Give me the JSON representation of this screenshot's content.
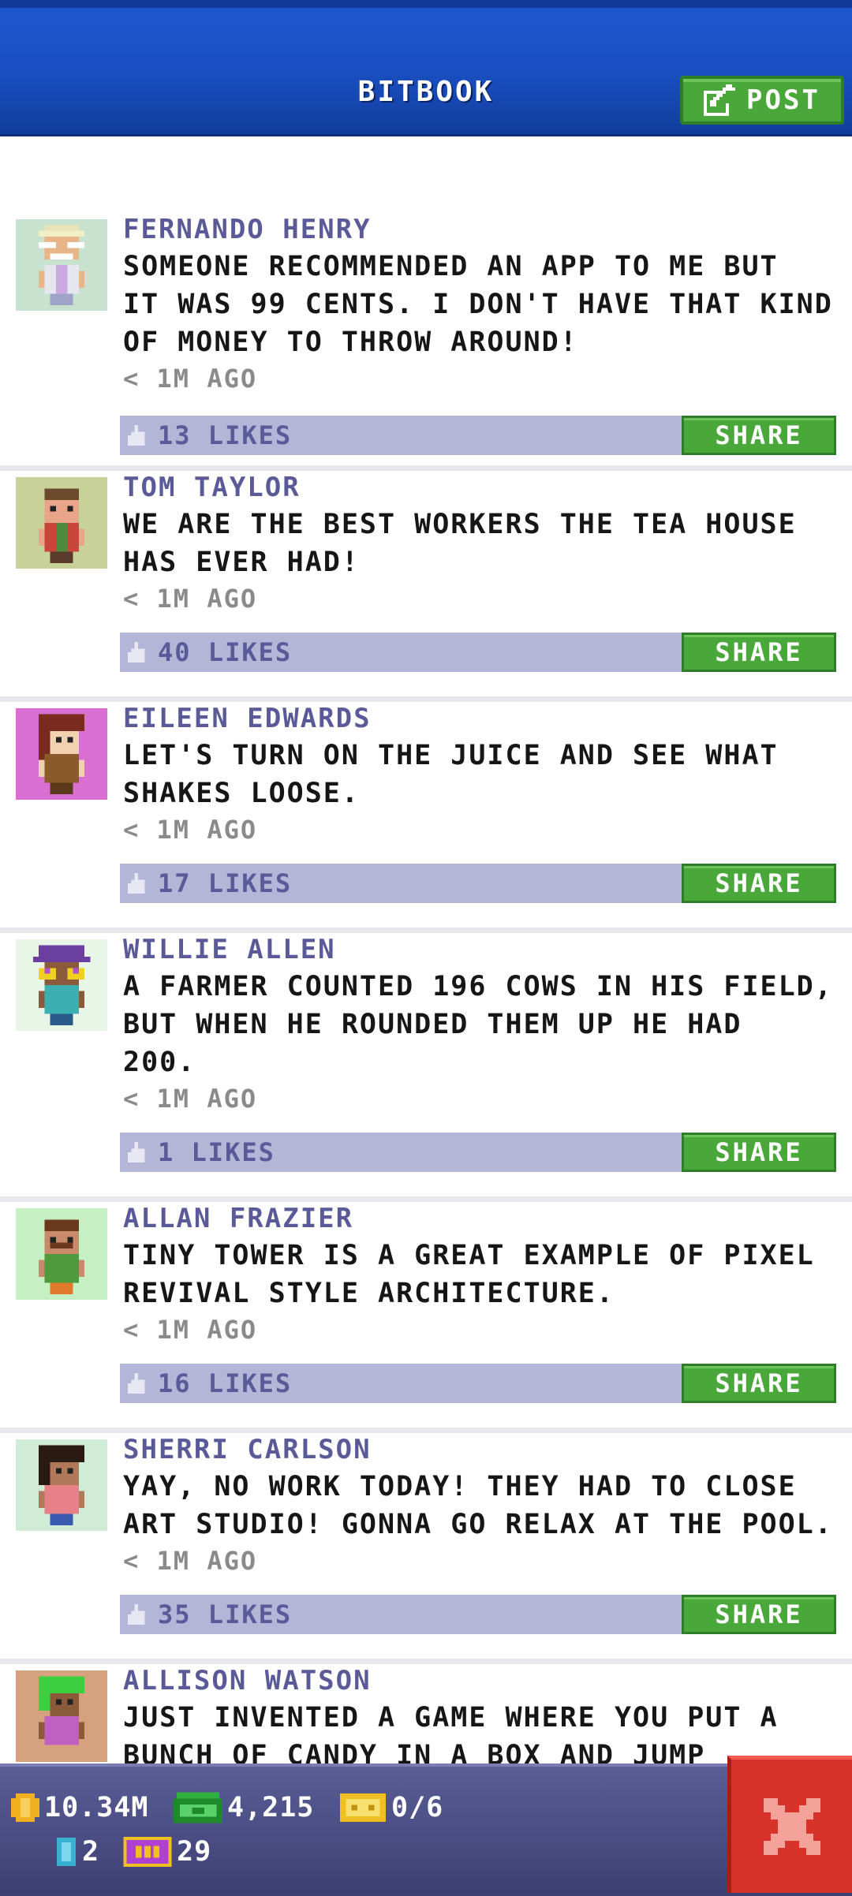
{
  "header": {
    "title": "BITBOOK",
    "post_label": "POST",
    "post_icon": "edit-icon"
  },
  "colors": {
    "header_blue": "#1a4fc2",
    "author": "#5a5a98",
    "likebar": "#b4b6d8",
    "share_green": "#4aa83a",
    "close_red": "#d8332b",
    "bottombar": "#4a4d85"
  },
  "posts": [
    {
      "author": "FERNANDO HENRY",
      "text": "SOMEONE RECOMMENDED AN APP TO ME BUT\nIT WAS 99 CENTS. I DON'T HAVE THAT KIND\nOF MONEY TO THROW AROUND!",
      "time": "< 1M AGO",
      "likes": "13 LIKES",
      "share": "SHARE",
      "avatar_bg": "#c9e2cf"
    },
    {
      "author": "TOM TAYLOR",
      "text": "WE ARE THE BEST WORKERS THE TEA HOUSE\nHAS EVER HAD!",
      "time": "< 1M AGO",
      "likes": "40 LIKES",
      "share": "SHARE",
      "avatar_bg": "#c8d298"
    },
    {
      "author": "EILEEN EDWARDS",
      "text": "LET'S TURN ON THE JUICE AND SEE WHAT\nSHAKES LOOSE.",
      "time": "< 1M AGO",
      "likes": "17 LIKES",
      "share": "SHARE",
      "avatar_bg": "#d96fd2"
    },
    {
      "author": "WILLIE ALLEN",
      "text": "A FARMER COUNTED 196 COWS IN HIS FIELD,\nBUT WHEN HE ROUNDED THEM UP HE HAD\n200.",
      "time": "< 1M AGO",
      "likes": "1 LIKES",
      "share": "SHARE",
      "avatar_bg": "#e8f6e8"
    },
    {
      "author": "ALLAN FRAZIER",
      "text": "TINY TOWER IS A GREAT EXAMPLE OF PIXEL\nREVIVAL STYLE ARCHITECTURE.",
      "time": "< 1M AGO",
      "likes": "16 LIKES",
      "share": "SHARE",
      "avatar_bg": "#c6efc4"
    },
    {
      "author": "SHERRI CARLSON",
      "text": "YAY, NO WORK TODAY! THEY HAD TO CLOSE\nART STUDIO! GONNA GO RELAX AT THE POOL.",
      "time": "< 1M AGO",
      "likes": "35 LIKES",
      "share": "SHARE",
      "avatar_bg": "#d0ecd6"
    },
    {
      "author": "ALLISON WATSON",
      "text": "JUST INVENTED A GAME WHERE YOU PUT A\nBUNCH OF CANDY IN A BOX AND JUMP",
      "time": "",
      "likes": "",
      "share": "",
      "avatar_bg": "#d6a27e"
    }
  ],
  "bottom_bar": {
    "coins": "10.34M",
    "bux": "4,215",
    "tickets": "0/6",
    "keys": "2",
    "vip": "29",
    "close_icon": "close-icon"
  }
}
